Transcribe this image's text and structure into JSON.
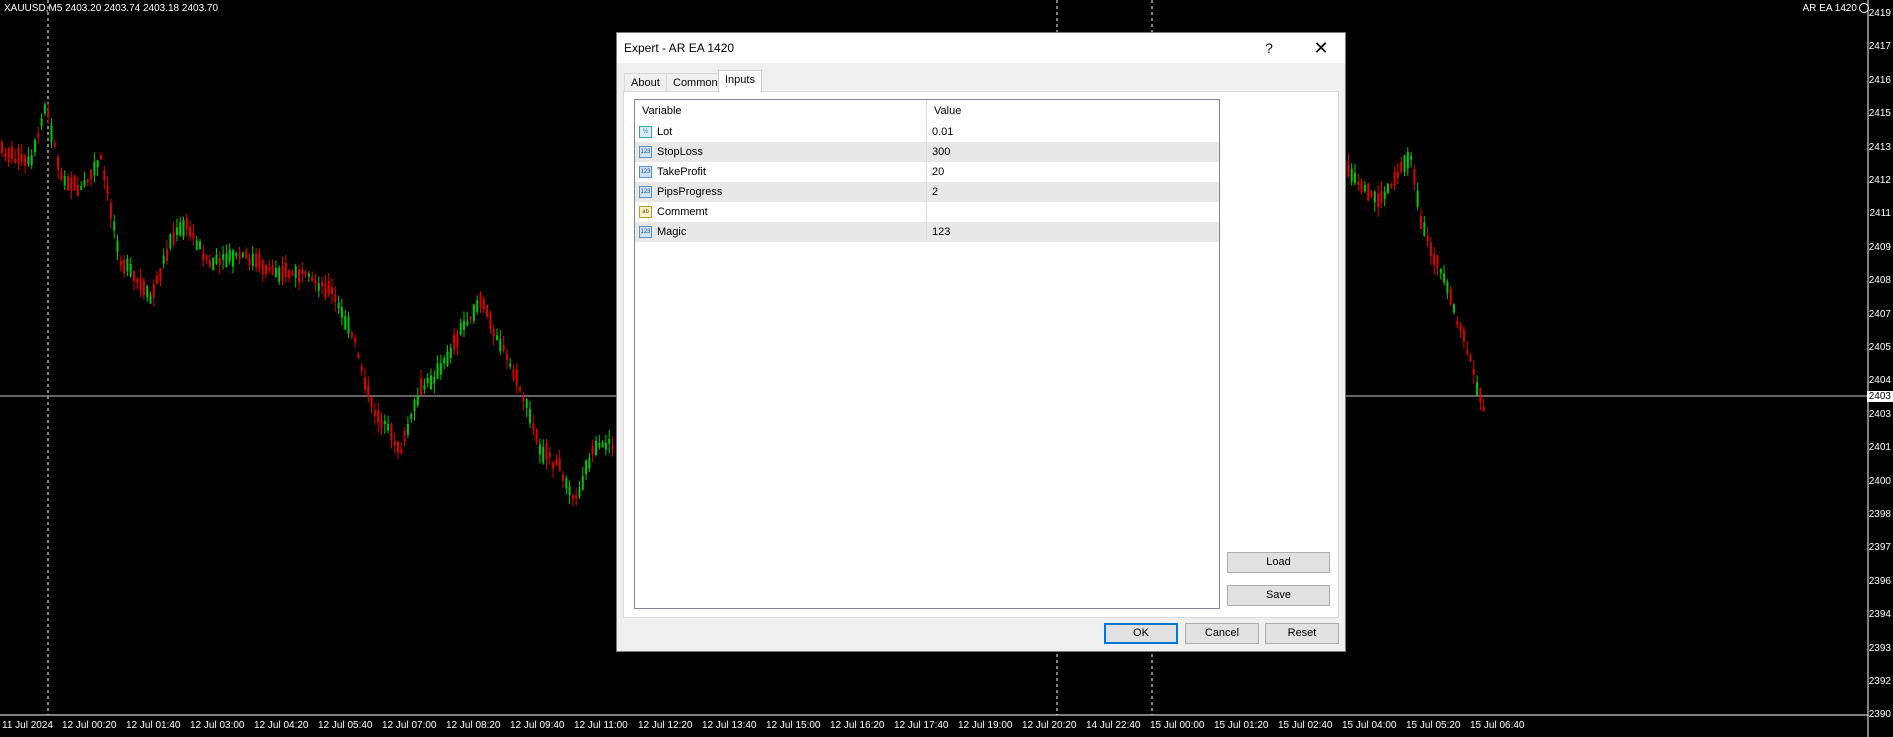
{
  "chart": {
    "symbol_info": "XAUUSD,M5  2403.20 2403.74 2403.18 2403.70",
    "ea_label": "AR EA 1420",
    "current_price": "2403",
    "bull_color": "#00c800",
    "bear_color": "#e00000",
    "price_ticks": [
      "2419",
      "2417",
      "2416",
      "2415",
      "2413",
      "2412",
      "2411",
      "2409",
      "2408",
      "2407",
      "2405",
      "2404",
      "2403",
      "2401",
      "2400",
      "2398",
      "2397",
      "2396",
      "2394",
      "2393",
      "2392",
      "2390"
    ],
    "time_ticks": [
      "11 Jul 2024",
      "12 Jul 00:20",
      "12 Jul 01:40",
      "12 Jul 03:00",
      "12 Jul 04:20",
      "12 Jul 05:40",
      "12 Jul 07:00",
      "12 Jul 08:20",
      "12 Jul 09:40",
      "12 Jul 11:00",
      "12 Jul 12:20",
      "12 Jul 13:40",
      "12 Jul 15:00",
      "12 Jul 16:20",
      "12 Jul 17:40",
      "12 Jul 19:00",
      "12 Jul 20:20",
      "14 Jul 22:40",
      "15 Jul 00:00",
      "15 Jul 01:20",
      "15 Jul 02:40",
      "15 Jul 04:00",
      "15 Jul 05:20",
      "15 Jul 06:40"
    ]
  },
  "dialog": {
    "title": "Expert - AR EA 1420",
    "help_glyph": "?",
    "close_glyph": "✕",
    "tabs": [
      {
        "label": "About"
      },
      {
        "label": "Common"
      },
      {
        "label": "Inputs",
        "active": true
      }
    ],
    "grid": {
      "header_variable": "Variable",
      "header_value": "Value",
      "rows": [
        {
          "icon": "double-type-icon",
          "badge": "½",
          "name": "Lot",
          "value": "0.01"
        },
        {
          "icon": "integer-type-icon",
          "badge": "123",
          "name": "StopLoss",
          "value": "300"
        },
        {
          "icon": "integer-type-icon",
          "badge": "123",
          "name": "TakeProfit",
          "value": "20"
        },
        {
          "icon": "integer-type-icon",
          "badge": "123",
          "name": "PipsProgress",
          "value": "2"
        },
        {
          "icon": "string-type-icon",
          "badge": "ab",
          "name": "Commemt",
          "value": ""
        },
        {
          "icon": "integer-type-icon",
          "badge": "123",
          "name": "Magic",
          "value": "123"
        }
      ]
    },
    "load_label": "Load",
    "save_label": "Save",
    "ok_label": "OK",
    "cancel_label": "Cancel",
    "reset_label": "Reset"
  }
}
